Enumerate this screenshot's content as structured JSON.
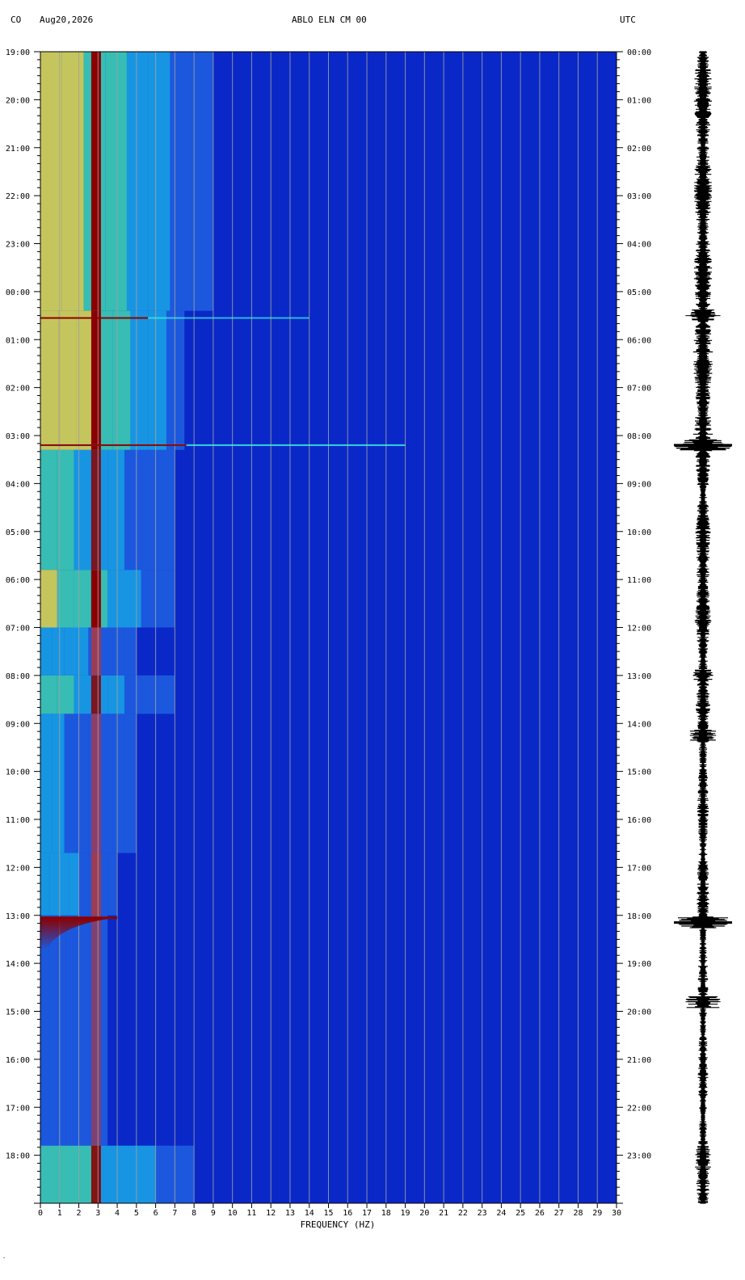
{
  "header": {
    "network": "CO",
    "date": "Aug20,2026",
    "station": "ABLO ELN CM 00",
    "timezone": "UTC"
  },
  "colors": {
    "background_blue": "#0a28c8",
    "grid": "#a0a0a0",
    "hot": "#8b0000",
    "trace": "#000000"
  },
  "chart_data": {
    "type": "heatmap",
    "title": "ABLO ELN CM 00",
    "xlabel": "FREQUENCY (HZ)",
    "ylabel": "",
    "xlim": [
      0,
      30
    ],
    "x_ticks": [
      "0",
      "1",
      "2",
      "3",
      "4",
      "5",
      "6",
      "7",
      "8",
      "9",
      "10",
      "11",
      "12",
      "13",
      "14",
      "15",
      "16",
      "17",
      "18",
      "19",
      "20",
      "21",
      "22",
      "23",
      "24",
      "25",
      "26",
      "27",
      "28",
      "29",
      "30"
    ],
    "y_ticks_left": [
      "19:00",
      "20:00",
      "21:00",
      "22:00",
      "23:00",
      "00:00",
      "01:00",
      "02:00",
      "03:00",
      "04:00",
      "05:00",
      "06:00",
      "07:00",
      "08:00",
      "09:00",
      "10:00",
      "11:00",
      "12:00",
      "13:00",
      "14:00",
      "15:00",
      "16:00",
      "17:00",
      "18:00"
    ],
    "y_ticks_right": [
      "00:00",
      "01:00",
      "02:00",
      "03:00",
      "04:00",
      "05:00",
      "06:00",
      "07:00",
      "08:00",
      "09:00",
      "10:00",
      "11:00",
      "12:00",
      "13:00",
      "14:00",
      "15:00",
      "16:00",
      "17:00",
      "18:00",
      "19:00",
      "20:00",
      "21:00",
      "22:00",
      "23:00"
    ],
    "hours_total": 24,
    "dominant_frequency_hz": 2.9,
    "energy_bands": [
      {
        "start_h": 0.0,
        "end_h": 5.4,
        "max_hz": 9.0,
        "level": 0.65
      },
      {
        "start_h": 5.4,
        "end_h": 8.3,
        "max_hz": 7.5,
        "level": 0.8
      },
      {
        "start_h": 8.3,
        "end_h": 10.8,
        "max_hz": 7.0,
        "level": 0.45
      },
      {
        "start_h": 10.8,
        "end_h": 12.0,
        "max_hz": 7.0,
        "level": 0.6
      },
      {
        "start_h": 12.0,
        "end_h": 13.0,
        "max_hz": 5.0,
        "level": 0.3
      },
      {
        "start_h": 13.0,
        "end_h": 13.8,
        "max_hz": 7.0,
        "level": 0.45
      },
      {
        "start_h": 13.8,
        "end_h": 16.7,
        "max_hz": 5.0,
        "level": 0.22
      },
      {
        "start_h": 16.7,
        "end_h": 18.0,
        "max_hz": 4.0,
        "level": 0.3
      },
      {
        "start_h": 18.0,
        "end_h": 22.8,
        "max_hz": 3.5,
        "level": 0.15
      },
      {
        "start_h": 22.8,
        "end_h": 24.0,
        "max_hz": 8.0,
        "level": 0.5
      }
    ],
    "events": [
      {
        "hour": 5.55,
        "max_hz": 14,
        "level": 0.7
      },
      {
        "hour": 8.2,
        "max_hz": 19,
        "level": 0.85
      },
      {
        "hour": 18.05,
        "max_hz": 4,
        "level": 1.0
      }
    ],
    "trace_bursts": [
      {
        "hour": 5.5,
        "amp": 0.6
      },
      {
        "hour": 8.2,
        "amp": 1.0
      },
      {
        "hour": 13.0,
        "amp": 0.35
      },
      {
        "hour": 14.25,
        "amp": 0.45
      },
      {
        "hour": 18.15,
        "amp": 1.0
      },
      {
        "hour": 19.8,
        "amp": 0.6
      }
    ]
  }
}
